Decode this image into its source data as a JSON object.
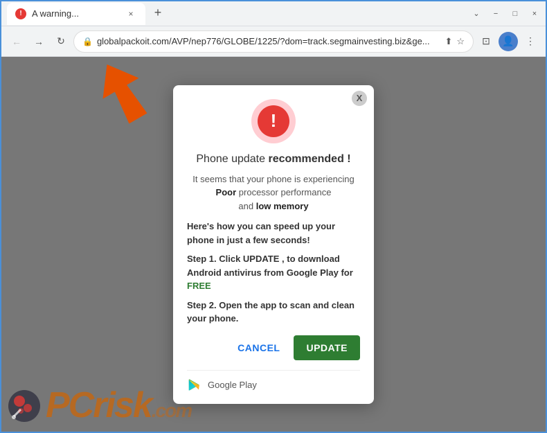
{
  "browser": {
    "tab": {
      "favicon_label": "!",
      "title": "A warning...",
      "close_label": "×"
    },
    "new_tab_label": "+",
    "window_controls": {
      "minimize": "−",
      "maximize": "□",
      "close": "×",
      "chevron_down": "⌄"
    },
    "nav": {
      "back_label": "←",
      "forward_label": "→",
      "reload_label": "↻",
      "url": "globalpackoit.com/AVP/nep776/GLOBE/1225/?dom=track.segmainvesting.biz&ge...",
      "share_label": "⬆",
      "bookmark_label": "☆",
      "extensions_label": "⊡",
      "profile_label": "👤",
      "menu_label": "⋮"
    }
  },
  "modal": {
    "close_label": "X",
    "title_normal": "Phone update ",
    "title_bold": "recommended !",
    "body": "It seems that your phone is experiencing ",
    "body_bold1": "Poor",
    "body_cont": " processor performance\nand ",
    "body_bold2": "low memory",
    "section1_title": "Here's how you can speed up your phone in just a few seconds!",
    "step1": "Step 1. Click UPDATE , to download Android antivirus from Google Play for ",
    "step1_free": "FREE",
    "step2": "Step 2. Open the app to scan and clean your phone.",
    "cancel_label": "CANCEL",
    "update_label": "UPDATE",
    "google_play_text": "Google Play"
  },
  "watermark": {
    "pc": "PC",
    "risk": "risk",
    "com": ".com"
  }
}
